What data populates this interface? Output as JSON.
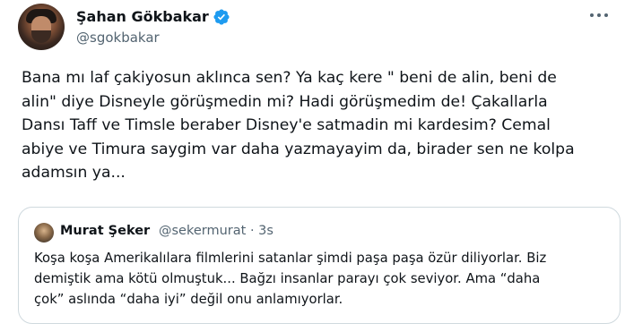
{
  "author": {
    "display_name": "Şahan Gökbakar",
    "handle": "@sgokbakar",
    "verified_badge_color": "#1d9bf0"
  },
  "tweet": {
    "text": "Bana mı laf çakiyosun aklınca sen? Ya kaç kere \" beni de alin, beni de\nalin\" diye Disneyle görüşmedin mi? Hadi görüşmedim de! Çakallarla\nDansı Taff ve Timsle beraber Disney'e satmadin mi kardesim? Cemal\nabiye ve Timura saygim var daha yazmayayim da, birader sen ne kolpa\nadamsın ya..."
  },
  "quoted_tweet": {
    "display_name": "Murat Şeker",
    "handle": "@sekermurat",
    "separator": "·",
    "time": "3s",
    "text": "Koşa koşa Amerikalılara filmlerini satanlar şimdi paşa paşa özür diliyorlar. Biz\ndemiştik ama kötü olmuştuk... Bağzı insanlar parayı çok seviyor. Ama “daha\nçok” aslında “daha iyi” değil onu anlamıyorlar."
  },
  "icons": {
    "verified": "verified-badge-icon",
    "more": "more-options-icon"
  },
  "colors": {
    "text_primary": "#0f1419",
    "text_secondary": "#536471",
    "border": "#cfd9de",
    "accent": "#1d9bf0"
  }
}
